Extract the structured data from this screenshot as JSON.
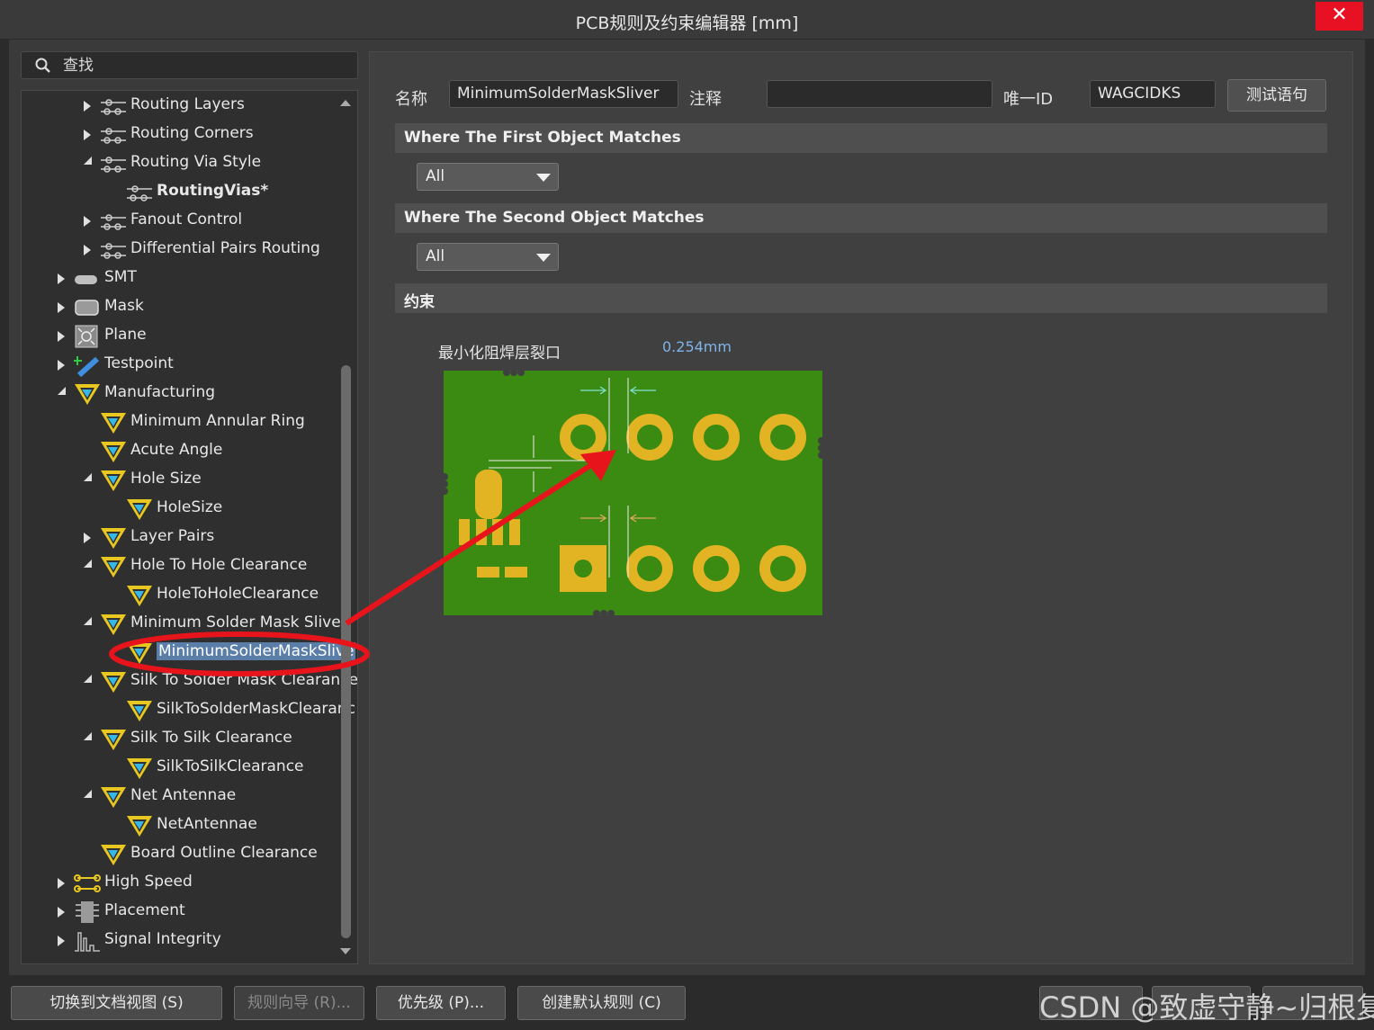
{
  "window": {
    "title": "PCB规则及约束编辑器 [mm]",
    "close_label": "✕"
  },
  "search": {
    "placeholder": "查找"
  },
  "tree": {
    "items": [
      {
        "label": "Routing Layers",
        "icon": "routing-icon",
        "expander": "collapsed"
      },
      {
        "label": "Routing Corners",
        "icon": "routing-icon",
        "expander": "collapsed"
      },
      {
        "label": "Routing Via Style",
        "icon": "routing-icon",
        "expander": "expanded"
      },
      {
        "label": "RoutingVias*",
        "icon": "routing-icon",
        "expander": "none",
        "bold": true
      },
      {
        "label": "Fanout Control",
        "icon": "routing-icon",
        "expander": "collapsed"
      },
      {
        "label": "Differential Pairs Routing",
        "icon": "routing-icon",
        "expander": "collapsed"
      },
      {
        "label": "SMT",
        "icon": "smt-icon",
        "expander": "collapsed"
      },
      {
        "label": "Mask",
        "icon": "mask-icon",
        "expander": "collapsed"
      },
      {
        "label": "Plane",
        "icon": "plane-icon",
        "expander": "collapsed"
      },
      {
        "label": "Testpoint",
        "icon": "testpoint-icon",
        "expander": "collapsed"
      },
      {
        "label": "Manufacturing",
        "icon": "rule-icon",
        "expander": "expanded"
      },
      {
        "label": "Minimum Annular Ring",
        "icon": "rule-icon",
        "expander": "none"
      },
      {
        "label": "Acute Angle",
        "icon": "rule-icon",
        "expander": "none"
      },
      {
        "label": "Hole Size",
        "icon": "rule-icon",
        "expander": "expanded"
      },
      {
        "label": "HoleSize",
        "icon": "rule-icon",
        "expander": "none"
      },
      {
        "label": "Layer Pairs",
        "icon": "rule-icon",
        "expander": "collapsed"
      },
      {
        "label": "Hole To Hole Clearance",
        "icon": "rule-icon",
        "expander": "expanded"
      },
      {
        "label": "HoleToHoleClearance",
        "icon": "rule-icon",
        "expander": "none"
      },
      {
        "label": "Minimum Solder Mask Sliver",
        "icon": "rule-icon",
        "expander": "expanded"
      },
      {
        "label": "MinimumSolderMaskSlive",
        "icon": "rule-icon",
        "expander": "none",
        "selected": true
      },
      {
        "label": "Silk To Solder Mask Clearance",
        "icon": "rule-icon",
        "expander": "expanded"
      },
      {
        "label": "SilkToSolderMaskClearanc",
        "icon": "rule-icon",
        "expander": "none"
      },
      {
        "label": "Silk To Silk Clearance",
        "icon": "rule-icon",
        "expander": "expanded"
      },
      {
        "label": "SilkToSilkClearance",
        "icon": "rule-icon",
        "expander": "none"
      },
      {
        "label": "Net Antennae",
        "icon": "rule-icon",
        "expander": "expanded"
      },
      {
        "label": "NetAntennae",
        "icon": "rule-icon",
        "expander": "none"
      },
      {
        "label": "Board Outline Clearance",
        "icon": "rule-icon",
        "expander": "none"
      },
      {
        "label": "High Speed",
        "icon": "highspeed-icon",
        "expander": "collapsed"
      },
      {
        "label": "Placement",
        "icon": "placement-icon",
        "expander": "collapsed"
      },
      {
        "label": "Signal Integrity",
        "icon": "signal-icon",
        "expander": "collapsed"
      }
    ]
  },
  "rule": {
    "name_label": "名称",
    "name_value": "MinimumSolderMaskSliver",
    "comment_label": "注释",
    "comment_value": "",
    "id_label": "唯一ID",
    "id_value": "WAGCIDKS",
    "test_button": "测试语句"
  },
  "first_match": {
    "header": "Where The First Object Matches",
    "selected": "All"
  },
  "second_match": {
    "header": "Where The Second Object Matches",
    "selected": "All"
  },
  "constraints": {
    "header": "约束",
    "label": "最小化阻焊层裂口",
    "value": "0.254mm"
  },
  "buttons": {
    "switch_view": "切换到文档视图 (S)",
    "rule_wizard": "规则向导 (R)...",
    "priority": "优先级 (P)...",
    "create_default": "创建默认规则 (C)"
  },
  "watermark": "CSDN @致虚守静~归根复命",
  "colors": {
    "selection": "#5a7ea8",
    "close": "#e81123",
    "pcb_green": "#3b8a12",
    "pad_gold": "#e2b424",
    "annotation_red": "#e8141c",
    "value_blue": "#7fb4ea"
  }
}
